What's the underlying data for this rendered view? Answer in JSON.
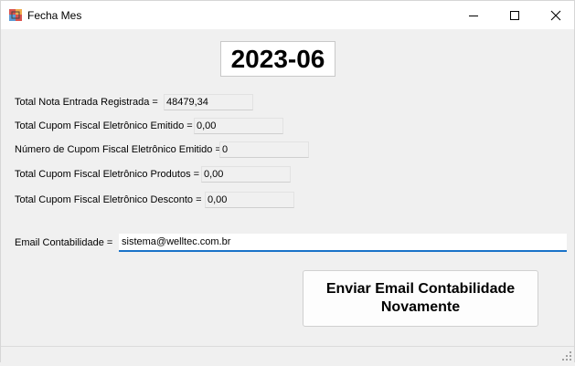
{
  "window": {
    "title": "Fecha Mes"
  },
  "period": "2023-06",
  "fields": [
    {
      "label": "Total Nota Entrada Registrada =",
      "value": "48479,34"
    },
    {
      "label": "Total Cupom Fiscal Eletrônico Emitido =",
      "value": "0,00"
    },
    {
      "label": "Número de Cupom Fiscal Eletrônico Emitido =",
      "value": "0"
    },
    {
      "label": "Total Cupom Fiscal Eletrônico Produtos =",
      "value": "0,00"
    },
    {
      "label": "Total Cupom Fiscal Eletrônico Desconto =",
      "value": "0,00"
    }
  ],
  "email": {
    "label": "Email Contabilidade =",
    "value": "sistema@welltec.com.br"
  },
  "button": {
    "label": "Enviar Email Contabilidade Novamente"
  },
  "colors": {
    "accent": "#1a73c9",
    "background": "#f0f0f0"
  },
  "icons": {
    "app": "app-icon",
    "minimize": "minimize-icon",
    "maximize": "maximize-icon",
    "close": "close-icon",
    "grip": "resize-grip-icon"
  }
}
